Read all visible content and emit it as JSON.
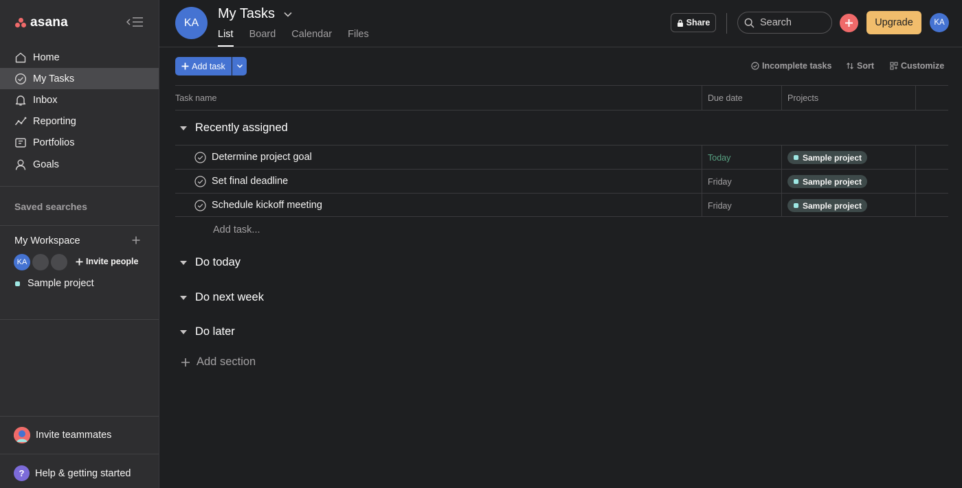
{
  "app": {
    "logo_text": "asana"
  },
  "sidebar": {
    "nav": [
      {
        "label": "Home",
        "icon": "home-icon"
      },
      {
        "label": "My Tasks",
        "icon": "check-circle-icon",
        "active": true
      },
      {
        "label": "Inbox",
        "icon": "bell-icon"
      },
      {
        "label": "Reporting",
        "icon": "line-chart-icon"
      },
      {
        "label": "Portfolios",
        "icon": "folder-icon"
      },
      {
        "label": "Goals",
        "icon": "person-icon"
      }
    ],
    "saved_searches": "Saved searches",
    "workspace": {
      "title": "My Workspace",
      "avatar_initials": "KA",
      "invite_label": "Invite people",
      "project": "Sample project"
    },
    "invite_teammates": "Invite teammates",
    "help": "Help & getting started",
    "help_glyph": "?"
  },
  "header": {
    "avatar_initials": "KA",
    "title": "My Tasks",
    "tabs": [
      "List",
      "Board",
      "Calendar",
      "Files"
    ],
    "active_tab": "List",
    "share_label": "Share",
    "search_placeholder": "Search",
    "upgrade_label": "Upgrade",
    "user_initials": "KA"
  },
  "toolbar": {
    "add_task_label": "Add task",
    "filter_label": "Incomplete tasks",
    "sort_label": "Sort",
    "customize_label": "Customize"
  },
  "table": {
    "columns": [
      "Task name",
      "Due date",
      "Projects"
    ],
    "sections": [
      {
        "name": "Recently assigned",
        "tasks": [
          {
            "name": "Determine project goal",
            "due": "Today",
            "project": "Sample project"
          },
          {
            "name": "Set final deadline",
            "due": "Friday",
            "project": "Sample project"
          },
          {
            "name": "Schedule kickoff meeting",
            "due": "Friday",
            "project": "Sample project"
          }
        ],
        "add_task_label": "Add task..."
      },
      {
        "name": "Do today"
      },
      {
        "name": "Do next week"
      },
      {
        "name": "Do later"
      }
    ],
    "add_section_label": "Add section"
  },
  "colors": {
    "accent_blue": "#4573d2",
    "upgrade_yellow": "#f1bd6c",
    "create_red": "#f06a6a",
    "today_green": "#58a182",
    "project_teal": "#9ee7e3"
  }
}
